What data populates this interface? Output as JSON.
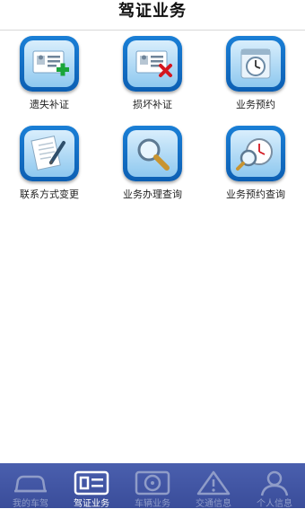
{
  "header": {
    "title": "驾证业务"
  },
  "tiles": [
    {
      "label": "遗失补证",
      "icon": "id-card-plus-icon"
    },
    {
      "label": "损坏补证",
      "icon": "id-card-delete-icon"
    },
    {
      "label": "业务预约",
      "icon": "calendar-clock-icon"
    },
    {
      "label": "联系方式变更",
      "icon": "document-edit-icon"
    },
    {
      "label": "业务办理查询",
      "icon": "magnifier-icon"
    },
    {
      "label": "业务预约查询",
      "icon": "clock-search-icon"
    }
  ],
  "tabbar": {
    "items": [
      {
        "label": "我的车驾",
        "icon": "car-icon",
        "active": false
      },
      {
        "label": "驾证业务",
        "icon": "license-icon",
        "active": true
      },
      {
        "label": "车辆业务",
        "icon": "steering-wheel-icon",
        "active": false
      },
      {
        "label": "交通信息",
        "icon": "warning-triangle-icon",
        "active": false
      },
      {
        "label": "个人信息",
        "icon": "user-icon",
        "active": false
      }
    ]
  },
  "colors": {
    "tabbar_bg": "#3f53a3",
    "tile_border": "#1570c6",
    "tile_face": "#bfe2f8"
  }
}
